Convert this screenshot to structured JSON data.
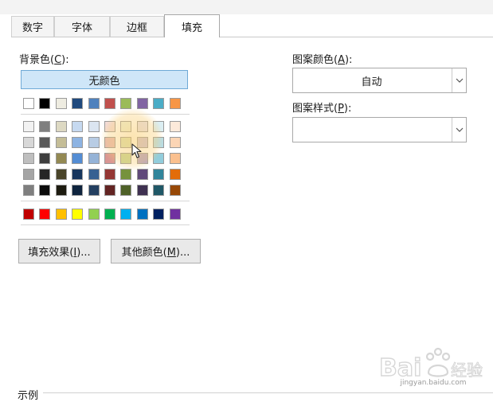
{
  "tabs": [
    {
      "label": "数字",
      "active": false
    },
    {
      "label": "字体",
      "active": false
    },
    {
      "label": "边框",
      "active": false
    },
    {
      "label": "填充",
      "active": true
    }
  ],
  "background": {
    "label_main": "背景色(",
    "label_key": "C",
    "label_tail": "):",
    "no_color": "无颜色",
    "row_theme": [
      "#ffffff",
      "#000000",
      "#eeece1",
      "#1f497d",
      "#4f81bd",
      "#c0504d",
      "#9bbb59",
      "#8064a2",
      "#4bacc6",
      "#f79646"
    ],
    "tint_rows": [
      [
        "#f2f2f2",
        "#7f7f7f",
        "#ddd9c3",
        "#c6d9f0",
        "#dbe5f1",
        "#f2dcdb",
        "#ebf1dd",
        "#e5e0ec",
        "#dbeef3",
        "#fdeada"
      ],
      [
        "#d8d8d8",
        "#595959",
        "#c4bd97",
        "#8db3e2",
        "#b8cce4",
        "#e5b9b7",
        "#d7e3bc",
        "#ccc1d9",
        "#b7dde8",
        "#fbd5b5"
      ],
      [
        "#bfbfbf",
        "#3f3f3f",
        "#938953",
        "#548dd4",
        "#95b3d7",
        "#d99694",
        "#c3d69b",
        "#b2a2c7",
        "#92cddc",
        "#fac08f"
      ],
      [
        "#a5a5a5",
        "#262626",
        "#494429",
        "#17365d",
        "#366092",
        "#953734",
        "#76923c",
        "#5f497a",
        "#31859b",
        "#e36c09"
      ],
      [
        "#7f7f7f",
        "#0c0c0c",
        "#1d1b10",
        "#0f243e",
        "#244061",
        "#632423",
        "#4f6128",
        "#3f3151",
        "#205867",
        "#974806"
      ]
    ],
    "row_standard": [
      "#c00000",
      "#ff0000",
      "#ffc000",
      "#ffff00",
      "#92d050",
      "#00b050",
      "#00b0f0",
      "#0070c0",
      "#002060",
      "#7030a0"
    ]
  },
  "buttons": {
    "fill_effects_main": "填充效果(",
    "fill_effects_key": "I",
    "fill_effects_tail": ")...",
    "more_colors_main": "其他颜色(",
    "more_colors_key": "M",
    "more_colors_tail": ")..."
  },
  "pattern": {
    "color_label_main": "图案颜色(",
    "color_label_key": "A",
    "color_label_tail": "):",
    "color_value": "自动",
    "style_label_main": "图案样式(",
    "style_label_key": "P",
    "style_label_tail": "):",
    "style_value": ""
  },
  "example": {
    "label": "示例"
  },
  "watermark": {
    "sub": "jingyan.baidu.com"
  }
}
